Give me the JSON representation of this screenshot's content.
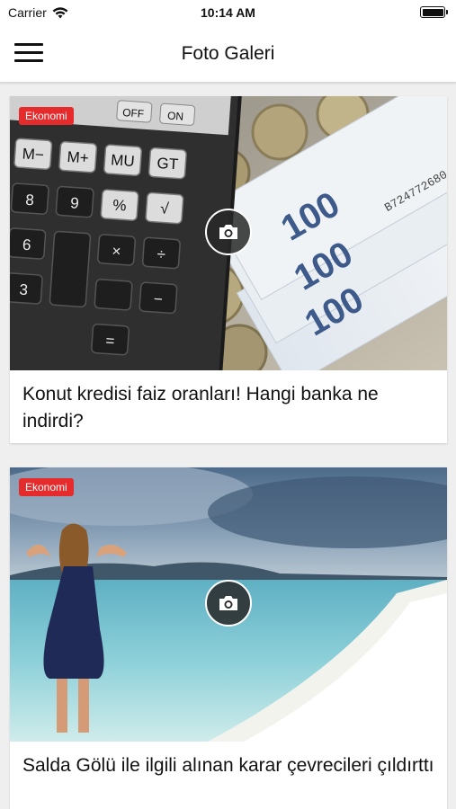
{
  "status_bar": {
    "carrier": "Carrier",
    "time": "10:14 AM"
  },
  "nav": {
    "title": "Foto Galeri"
  },
  "cards": [
    {
      "category": "Ekonomi",
      "title": "Konut kredisi faiz oranları! Hangi banka ne indirdi?"
    },
    {
      "category": "Ekonomi",
      "title": "Salda Gölü ile ilgili alınan karar çevrecileri çıldırttı"
    }
  ],
  "image_text": {
    "calc_keys": [
      "M−",
      "M+",
      "MU",
      "GT",
      "%",
      "√",
      "8",
      "9",
      "6",
      "3",
      "×",
      "÷",
      "−",
      "="
    ],
    "calc_switch": [
      "OFF",
      "ON"
    ],
    "banknote": "100",
    "serial": "B724772680"
  },
  "colors": {
    "badge": "#e52b2b",
    "text": "#111111",
    "nav_bg": "#ffffff",
    "page_bg": "#efefef"
  }
}
